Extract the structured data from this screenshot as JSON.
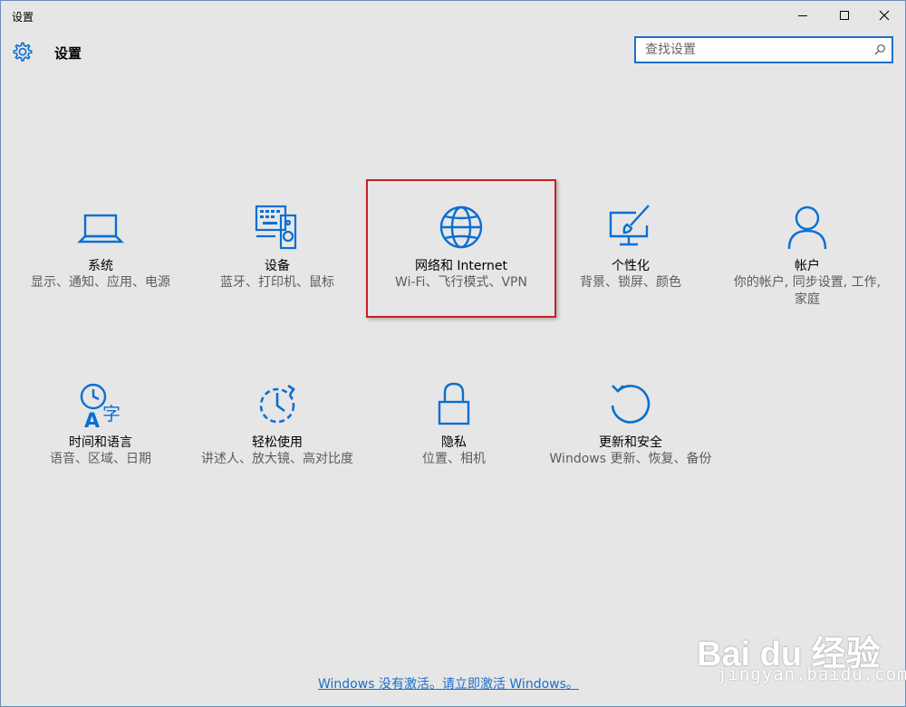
{
  "window": {
    "title": "设置"
  },
  "header": {
    "title": "设置"
  },
  "search": {
    "placeholder": "查找设置"
  },
  "tiles": [
    {
      "name": "系统",
      "desc": "显示、通知、应用、电源"
    },
    {
      "name": "设备",
      "desc": "蓝牙、打印机、鼠标"
    },
    {
      "name": "网络和 Internet",
      "desc": "Wi-Fi、飞行模式、VPN"
    },
    {
      "name": "个性化",
      "desc": "背景、锁屏、颜色"
    },
    {
      "name": "帐户",
      "desc": "你的帐户, 同步设置, 工作, 家庭"
    },
    {
      "name": "时间和语言",
      "desc": "语音、区域、日期"
    },
    {
      "name": "轻松使用",
      "desc": "讲述人、放大镜、高对比度"
    },
    {
      "name": "隐私",
      "desc": "位置、相机"
    },
    {
      "name": "更新和安全",
      "desc": "Windows 更新、恢复、备份"
    }
  ],
  "activation_link": "Windows 没有激活。请立即激活 Windows。",
  "watermark": {
    "logo": "Bai du 经验",
    "url": "jingyan.baidu.com"
  },
  "colors": {
    "accent": "#0063b1",
    "icon": "#0a6fd1",
    "selection_border": "#c91f26",
    "link": "#1a6fcb"
  }
}
